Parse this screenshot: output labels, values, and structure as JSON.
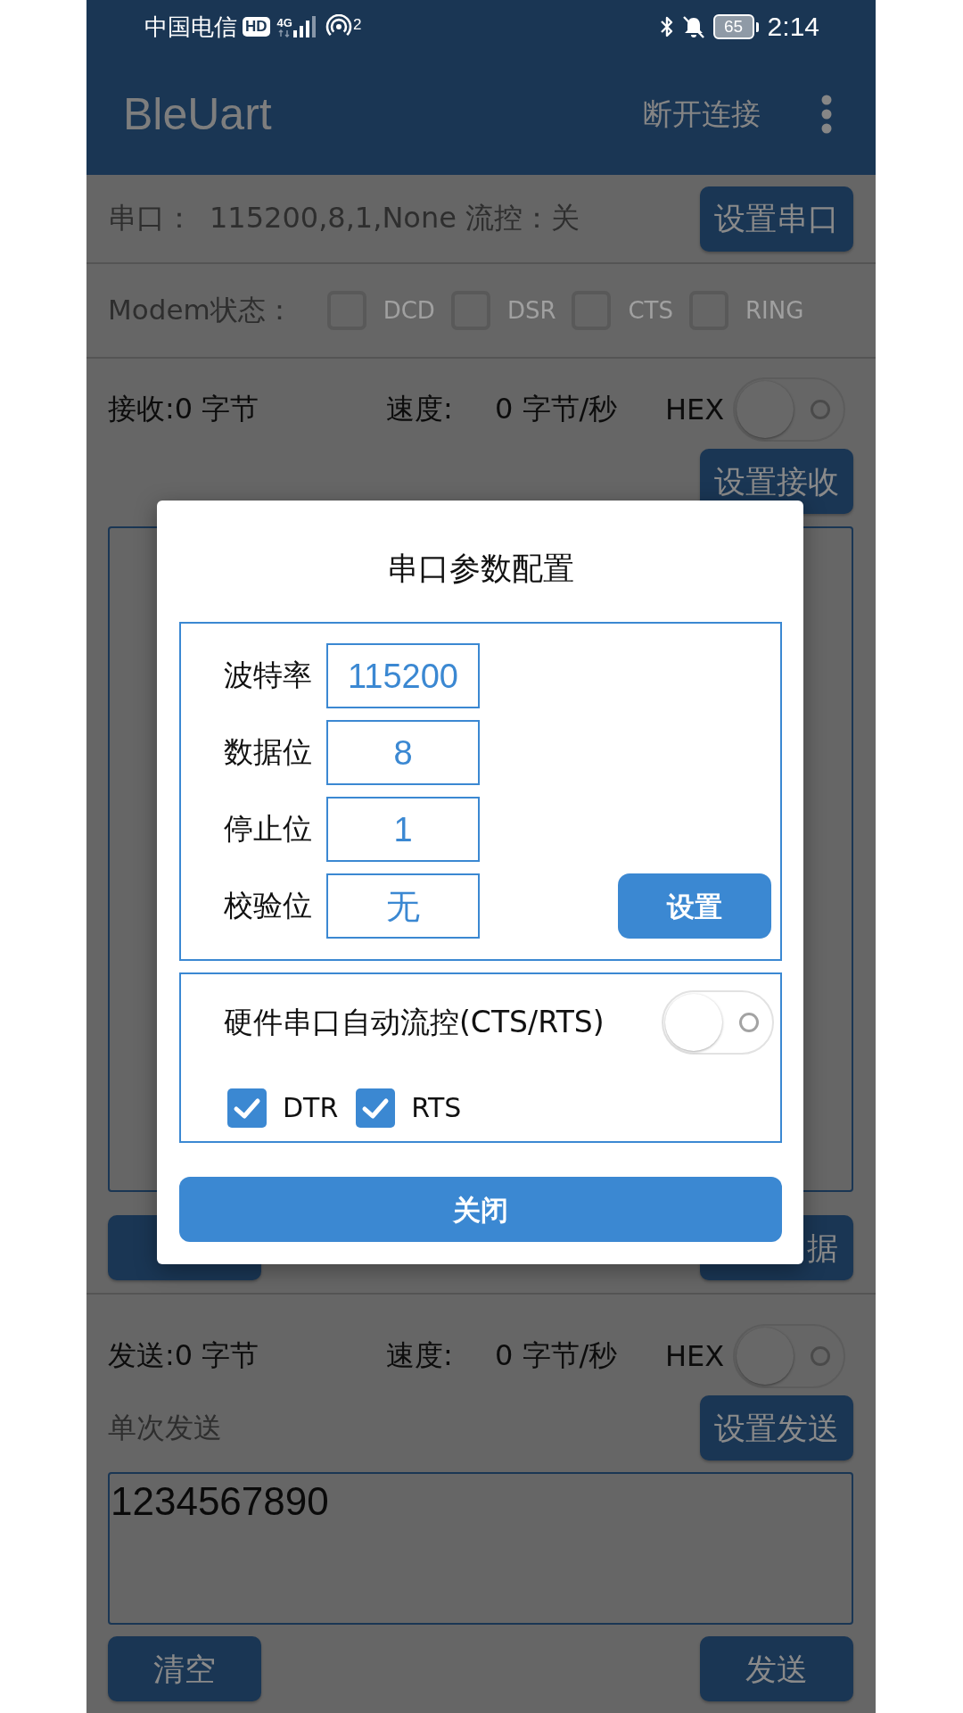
{
  "status_bar": {
    "carrier": "中国电信",
    "hd_badge": "HD",
    "network_type": "4G",
    "hotspot_count": "2",
    "battery": "65",
    "time": "2:14"
  },
  "app_bar": {
    "title": "BleUart",
    "action": "断开连接"
  },
  "serial_row": {
    "label": "串口：",
    "value": "115200,8,1,None 流控：关",
    "button": "设置串口"
  },
  "modem_row": {
    "label": "Modem状态：",
    "lines": [
      {
        "label": "DCD",
        "checked": false
      },
      {
        "label": "DSR",
        "checked": false
      },
      {
        "label": "CTS",
        "checked": false
      },
      {
        "label": "RING",
        "checked": false
      }
    ]
  },
  "receive": {
    "count": "接收:0 字节",
    "speed_label": "速度:",
    "speed": "0 字节/秒",
    "hex_label": "HEX",
    "hex_on": false,
    "button": "设置接收",
    "right_button": "据"
  },
  "send": {
    "count": "发送:0 字节",
    "speed_label": "速度:",
    "speed": "0 字节/秒",
    "hex_label": "HEX",
    "hex_on": false,
    "mode": "单次发送",
    "button": "设置发送",
    "text": "1234567890",
    "buttons": [
      "清空",
      "发送"
    ]
  },
  "dialog": {
    "title": "串口参数配置",
    "params": [
      {
        "label": "波特率",
        "value": "115200"
      },
      {
        "label": "数据位",
        "value": "8"
      },
      {
        "label": "停止位",
        "value": "1"
      },
      {
        "label": "校验位",
        "value": "无"
      }
    ],
    "set_button": "设置",
    "flow_control": {
      "label": "硬件串口自动流控(CTS/RTS)",
      "on": false
    },
    "lines": [
      {
        "label": "DTR",
        "checked": true
      },
      {
        "label": "RTS",
        "checked": true
      }
    ],
    "close_button": "关闭"
  }
}
